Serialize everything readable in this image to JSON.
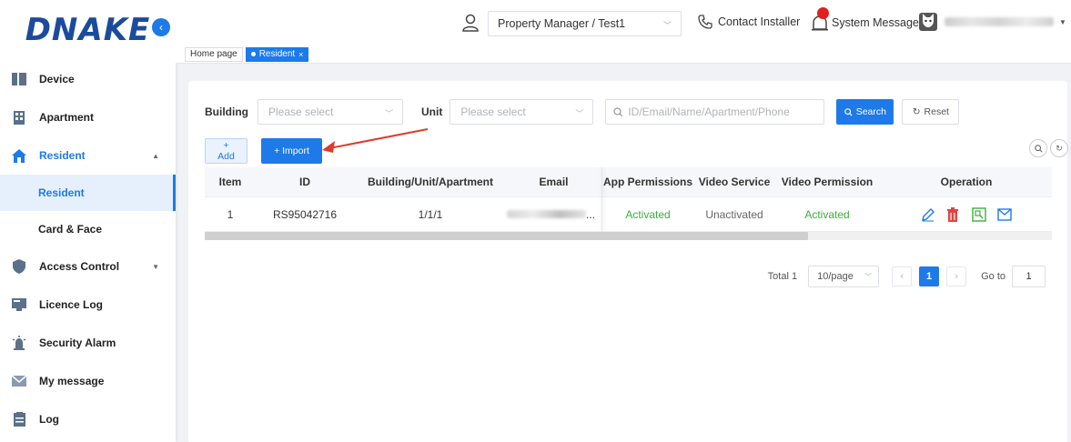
{
  "brand": {
    "logo_text": "DNAKE"
  },
  "header": {
    "role": "Property Manager / Test1",
    "contact": "Contact Installer",
    "system_message": "System Message"
  },
  "tabs": [
    {
      "label": "Home page"
    },
    {
      "label": "Resident"
    }
  ],
  "sidebar": {
    "items": [
      {
        "label": "Device",
        "icon": "device-icon"
      },
      {
        "label": "Apartment",
        "icon": "building-icon"
      },
      {
        "label": "Resident",
        "icon": "home-icon",
        "expanded": true
      },
      {
        "label": "Resident",
        "sub": true,
        "active": true
      },
      {
        "label": "Card & Face",
        "sub": true
      },
      {
        "label": "Access Control",
        "icon": "shield-icon"
      },
      {
        "label": "Licence Log",
        "icon": "licence-icon"
      },
      {
        "label": "Security Alarm",
        "icon": "alarm-icon"
      },
      {
        "label": "My message",
        "icon": "mail-icon"
      },
      {
        "label": "Log",
        "icon": "log-icon"
      }
    ]
  },
  "filters": {
    "building_label": "Building",
    "building_placeholder": "Please select",
    "unit_label": "Unit",
    "unit_placeholder": "Please select",
    "search_placeholder": "ID/Email/Name/Apartment/Phone",
    "search_button": "Search",
    "reset_button": "Reset"
  },
  "actions": {
    "add_button": "+ Add",
    "import_button": "+ Import"
  },
  "table": {
    "columns": [
      "Item",
      "ID",
      "Building/Unit/Apartment",
      "Email",
      "App Permissions",
      "Video Service",
      "Video Permission",
      "Operation"
    ],
    "rows": [
      {
        "item": "1",
        "id": "RS95042716",
        "location": "1/1/1",
        "email_suffix": "...",
        "app_permissions": "Activated",
        "video_service": "Unactivated",
        "video_permission": "Activated"
      }
    ]
  },
  "pagination": {
    "total": "Total 1",
    "page_size": "10/page",
    "current_page": "1",
    "goto_label": "Go to",
    "goto_value": "1"
  },
  "colors": {
    "primary": "#1e7ae8",
    "logo": "#1b4b9e",
    "activated": "#3cae3c",
    "annotation": "#e03a2b",
    "delete": "#e04444"
  }
}
